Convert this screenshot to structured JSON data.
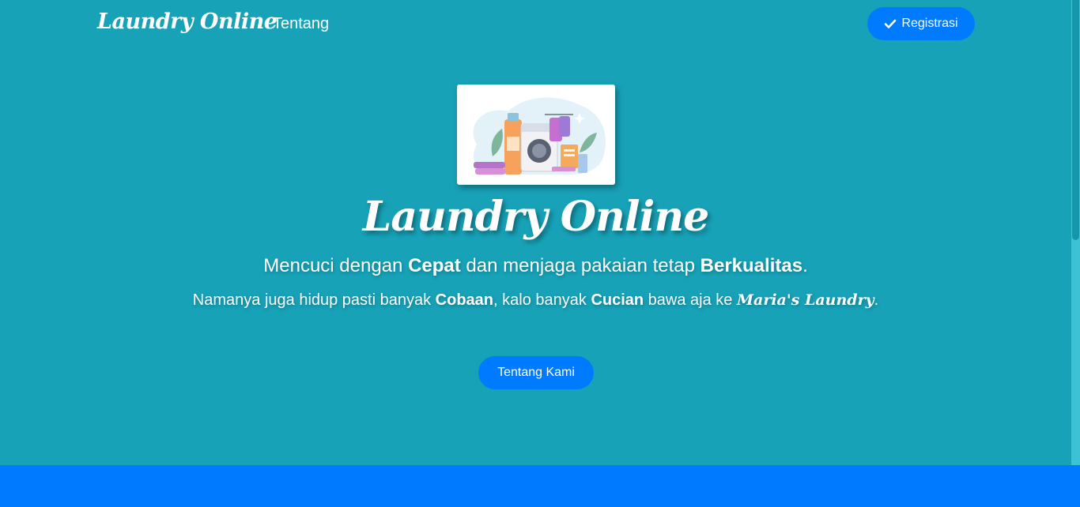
{
  "nav": {
    "brand": "Laundry Online",
    "link_about": "Tentang",
    "register_label": "Registrasi",
    "register_icon": "check-icon"
  },
  "hero": {
    "image_icon": "laundry-illustration",
    "title": "Laundry Online",
    "tagline": {
      "p1": "Mencuci dengan ",
      "b1": "Cepat",
      "p2": " dan menjaga pakaian tetap ",
      "b2": "Berkualitas",
      "p3": "."
    },
    "subline": {
      "p1": "Namanya juga hidup pasti banyak ",
      "b1": "Cobaan",
      "p2": ", kalo banyak ",
      "b2": "Cucian",
      "p3": " bawa aja ke ",
      "brand": "Maria's Laundry",
      "p4": "."
    },
    "about_button": "Tentang Kami"
  },
  "colors": {
    "background": "#17a2b8",
    "primary": "#007bff",
    "text": "#ffffff"
  }
}
